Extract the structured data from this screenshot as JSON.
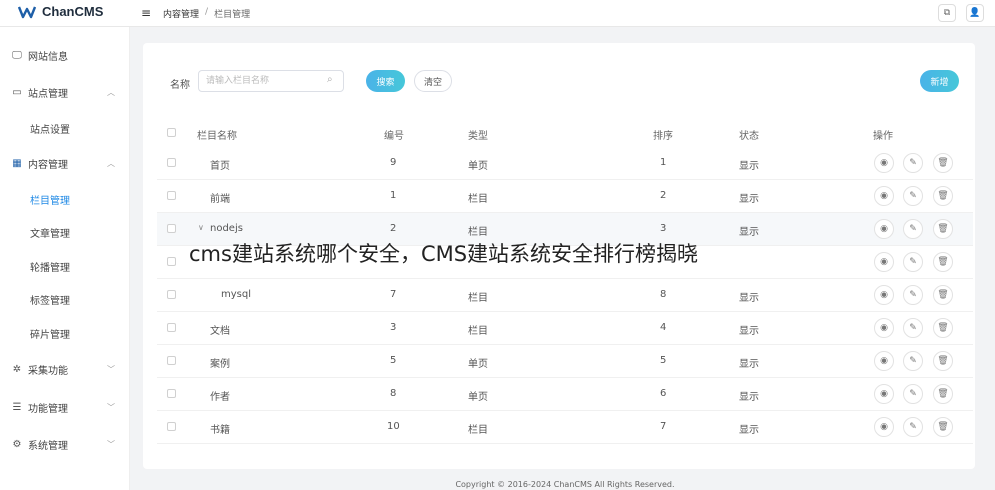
{
  "app": {
    "logo_text": "ChanCMS"
  },
  "breadcrumb": {
    "parent": "内容管理",
    "separator": "/",
    "current": "栏目管理"
  },
  "topbar": {
    "external_icon": "external-link-icon",
    "user_icon": "user-icon"
  },
  "sidebar": {
    "items": [
      {
        "label": "网站信息",
        "icon": "monitor-check-icon",
        "expandable": false
      },
      {
        "label": "站点管理",
        "icon": "desktop-icon",
        "expandable": true,
        "chevron": "^"
      },
      {
        "label": "站点设置",
        "sub": true
      },
      {
        "label": "内容管理",
        "icon": "grid-icon",
        "expandable": true,
        "chevron": "^"
      },
      {
        "label": "栏目管理",
        "sub": true,
        "active": true
      },
      {
        "label": "文章管理",
        "sub": true
      },
      {
        "label": "轮播管理",
        "sub": true
      },
      {
        "label": "标签管理",
        "sub": true
      },
      {
        "label": "碎片管理",
        "sub": true
      },
      {
        "label": "采集功能",
        "icon": "spider-icon",
        "expandable": true,
        "chevron": "v"
      },
      {
        "label": "功能管理",
        "icon": "sliders-icon",
        "expandable": true,
        "chevron": "v"
      },
      {
        "label": "系统管理",
        "icon": "gear-icon",
        "expandable": true,
        "chevron": "v"
      }
    ]
  },
  "filter": {
    "name_label": "名称",
    "name_placeholder": "请输入栏目名称",
    "search_label": "搜索",
    "clear_label": "清空",
    "add_label": "新增"
  },
  "table": {
    "columns": [
      "栏目名称",
      "编号",
      "类型",
      "排序",
      "状态",
      "操作"
    ],
    "rows": [
      {
        "name": "首页",
        "id": "9",
        "type": "单页",
        "order": "1",
        "status": "显示"
      },
      {
        "name": "前端",
        "id": "1",
        "type": "栏目",
        "order": "2",
        "status": "显示"
      },
      {
        "name": "nodejs",
        "id": "2",
        "type": "栏目",
        "order": "3",
        "status": "显示",
        "expanded": true
      },
      {
        "name": "",
        "id": "",
        "type": "",
        "order": "",
        "status": ""
      },
      {
        "name": "mysql",
        "id": "7",
        "type": "栏目",
        "order": "8",
        "status": "显示"
      },
      {
        "name": "文档",
        "id": "3",
        "type": "栏目",
        "order": "4",
        "status": "显示"
      },
      {
        "name": "案例",
        "id": "5",
        "type": "单页",
        "order": "5",
        "status": "显示"
      },
      {
        "name": "作者",
        "id": "8",
        "type": "单页",
        "order": "6",
        "status": "显示"
      },
      {
        "name": "书籍",
        "id": "10",
        "type": "栏目",
        "order": "7",
        "status": "显示"
      }
    ],
    "action_icons": [
      "eye-icon",
      "edit-icon",
      "trash-icon"
    ]
  },
  "overlay_text": "cms建站系统哪个安全，CMS建站系统安全排行榜揭晓",
  "footer": "Copyright © 2016-2024 ChanCMS All Rights Reserved."
}
